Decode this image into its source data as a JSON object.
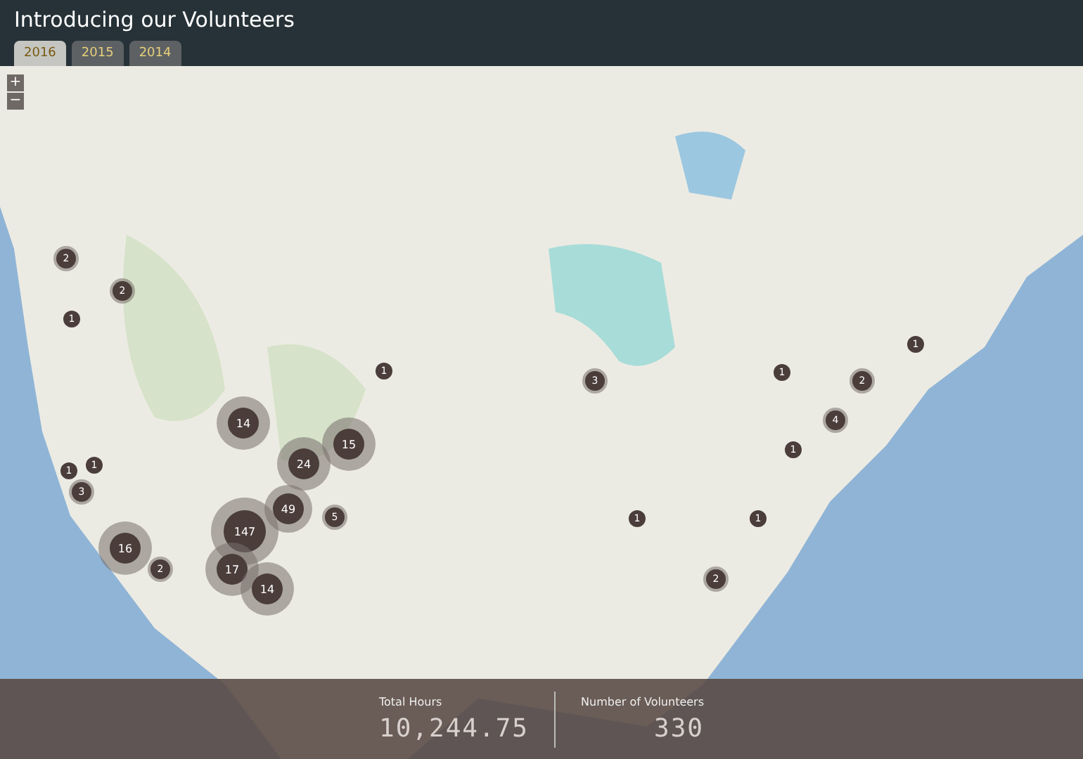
{
  "header": {
    "title": "Introducing our Volunteers"
  },
  "tabs": [
    {
      "label": "2016",
      "selected": true
    },
    {
      "label": "2015",
      "selected": false
    },
    {
      "label": "2014",
      "selected": false
    }
  ],
  "zoom_controls": [
    "+",
    "−"
  ],
  "markers": [
    {
      "count": "2"
    },
    {
      "count": "2"
    },
    {
      "count": "1"
    },
    {
      "count": "1"
    },
    {
      "count": "14"
    },
    {
      "count": "15"
    },
    {
      "count": "24"
    },
    {
      "count": "1"
    },
    {
      "count": "1"
    },
    {
      "count": "3"
    },
    {
      "count": "49"
    },
    {
      "count": "5"
    },
    {
      "count": "147"
    },
    {
      "count": "16"
    },
    {
      "count": "2"
    },
    {
      "count": "17"
    },
    {
      "count": "14"
    },
    {
      "count": "3"
    },
    {
      "count": "1"
    },
    {
      "count": "2"
    },
    {
      "count": "1"
    },
    {
      "count": "4"
    },
    {
      "count": "1"
    },
    {
      "count": "1"
    },
    {
      "count": "1"
    },
    {
      "count": "2"
    }
  ],
  "stats": [
    {
      "label": "Total Hours",
      "value": "10,244.75"
    },
    {
      "label": "Number of Volunteers",
      "value": "330"
    }
  ]
}
